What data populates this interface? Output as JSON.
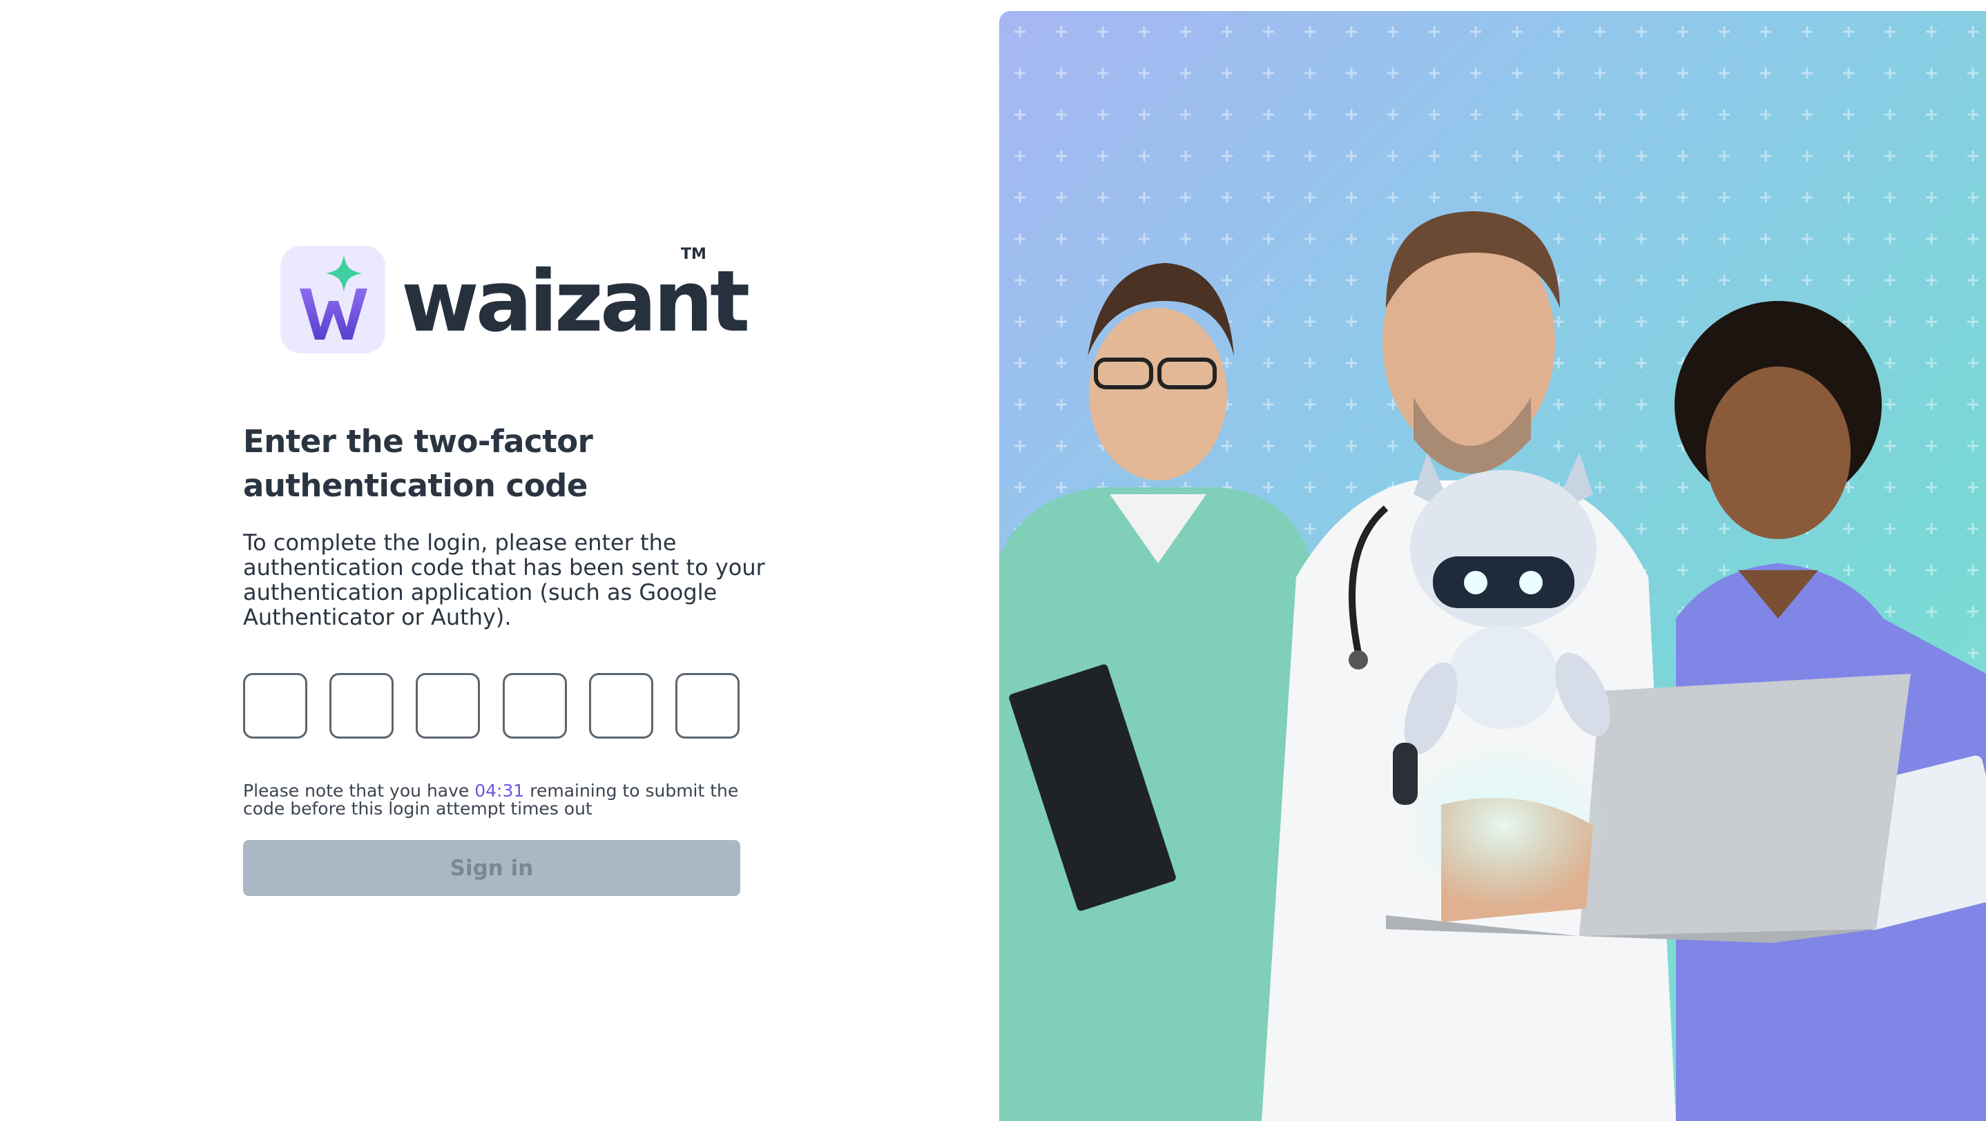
{
  "brand": {
    "name": "waizant",
    "trademark": "TM"
  },
  "title": "Enter the two-factor authentication code",
  "description": "To complete the login, please enter the authentication code that has been sent to your authentication application (such as Google Authenticator or Authy).",
  "code": {
    "digits": [
      "",
      "",
      "",
      "",
      "",
      ""
    ]
  },
  "notice": {
    "before": "Please note that you have ",
    "timer": "04:31",
    "after": " remaining to submit the code before this login attempt times out"
  },
  "signin": {
    "label": "Sign in",
    "disabled": true
  },
  "colors": {
    "accent": "#6b57e0",
    "button_disabled": "#aab8c5",
    "text": "#2b3542"
  }
}
